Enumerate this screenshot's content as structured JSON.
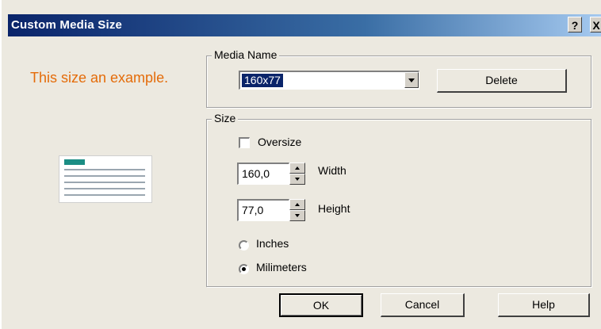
{
  "window": {
    "title": "Custom Media Size",
    "help_glyph": "?",
    "close_glyph": "X"
  },
  "example": {
    "label": "This size an example."
  },
  "media_name": {
    "legend": "Media Name",
    "value": "160x77",
    "delete_label": "Delete"
  },
  "size": {
    "legend": "Size",
    "oversize_label": "Oversize",
    "oversize_checked": false,
    "width_value": "160,0",
    "width_label": "Width",
    "height_value": "77,0",
    "height_label": "Height",
    "inches_label": "Inches",
    "millimeters_label": "Milimeters",
    "selected_unit": "Milimeters"
  },
  "buttons": {
    "ok": "OK",
    "cancel": "Cancel",
    "help": "Help"
  },
  "colors": {
    "title_gradient_start": "#0a246a",
    "example_text": "#e46c0a",
    "preview_tab": "#1b8d84"
  }
}
